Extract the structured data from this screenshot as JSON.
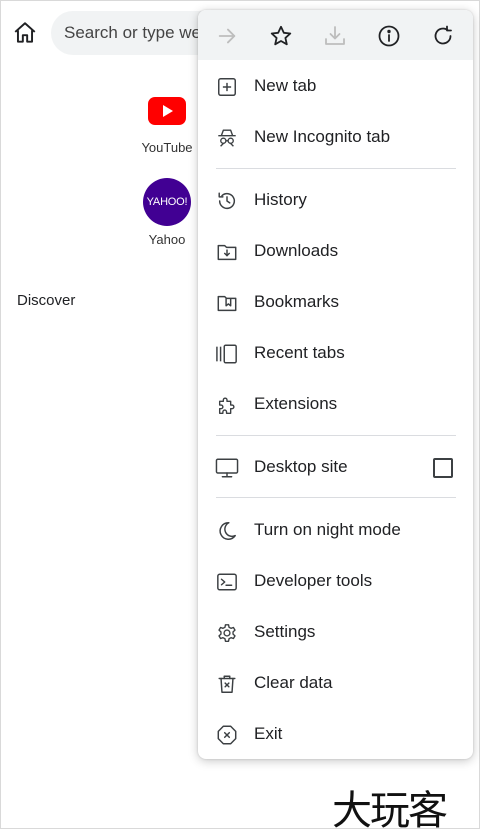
{
  "omnibox": {
    "placeholder": "Search or type we"
  },
  "shortcuts": [
    {
      "label": "YouTube"
    },
    {
      "label": "Yahoo",
      "logo_text": "YAHOO!"
    }
  ],
  "discover": {
    "label": "Discover"
  },
  "menu": {
    "toolbar": {
      "icons": [
        "forward-arrow-icon",
        "star-icon",
        "download-icon",
        "info-icon",
        "reload-icon"
      ]
    },
    "items": [
      {
        "label": "New tab",
        "icon": "plus-square-icon"
      },
      {
        "label": "New Incognito tab",
        "icon": "incognito-icon"
      },
      {
        "label": "History",
        "icon": "history-icon"
      },
      {
        "label": "Downloads",
        "icon": "download-folder-icon"
      },
      {
        "label": "Bookmarks",
        "icon": "bookmarks-icon"
      },
      {
        "label": "Recent tabs",
        "icon": "recent-tabs-icon"
      },
      {
        "label": "Extensions",
        "icon": "puzzle-icon"
      },
      {
        "label": "Desktop site",
        "icon": "monitor-icon",
        "checked": false
      },
      {
        "label": "Turn on night mode",
        "icon": "moon-icon"
      },
      {
        "label": "Developer tools",
        "icon": "terminal-icon"
      },
      {
        "label": "Settings",
        "icon": "gear-icon"
      },
      {
        "label": "Clear data",
        "icon": "trash-icon"
      },
      {
        "label": "Exit",
        "icon": "exit-icon"
      }
    ]
  },
  "watermark": {
    "text": "大玩客"
  },
  "colors": {
    "youtube_red": "#ff0000",
    "yahoo_purple": "#410093",
    "toolbar_bg": "#f1f3f4",
    "disabled_icon": "#bdbdbd"
  }
}
